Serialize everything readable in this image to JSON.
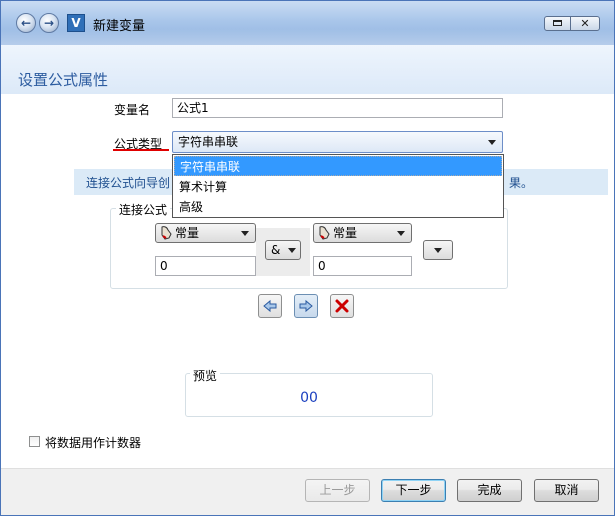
{
  "window": {
    "title": "新建变量"
  },
  "header": {
    "page_title": "设置公式属性"
  },
  "form": {
    "var_name_label": "变量名",
    "var_name_value": "公式1",
    "formula_type_label": "公式类型",
    "formula_type_selected": "字符串串联",
    "formula_type_options": [
      "字符串串联",
      "算术计算",
      "高级"
    ]
  },
  "info": {
    "text_left": "连接公式向导创",
    "text_right": "果。"
  },
  "connect_group": {
    "legend": "连接公式",
    "left_type": "常量",
    "left_value": "0",
    "operator": "&",
    "right_type": "常量",
    "right_value": "0"
  },
  "preview": {
    "legend": "预览",
    "value": "00"
  },
  "options": {
    "use_as_counter_label": "将数据用作计数器",
    "use_as_counter_checked": false
  },
  "footer": {
    "prev_label": "上一步",
    "next_label": "下一步",
    "finish_label": "完成",
    "cancel_label": "取消"
  },
  "colors": {
    "accent": "#2d5ca0",
    "selection": "#3399ff",
    "delete": "#cc0000",
    "underline": "#e00000"
  },
  "icons": {
    "back": "back-arrow-icon",
    "forward": "forward-arrow-icon",
    "move_left": "move-left-icon",
    "move_right": "move-right-icon",
    "delete": "delete-x-icon",
    "constant": "hand-pointer-icon"
  }
}
